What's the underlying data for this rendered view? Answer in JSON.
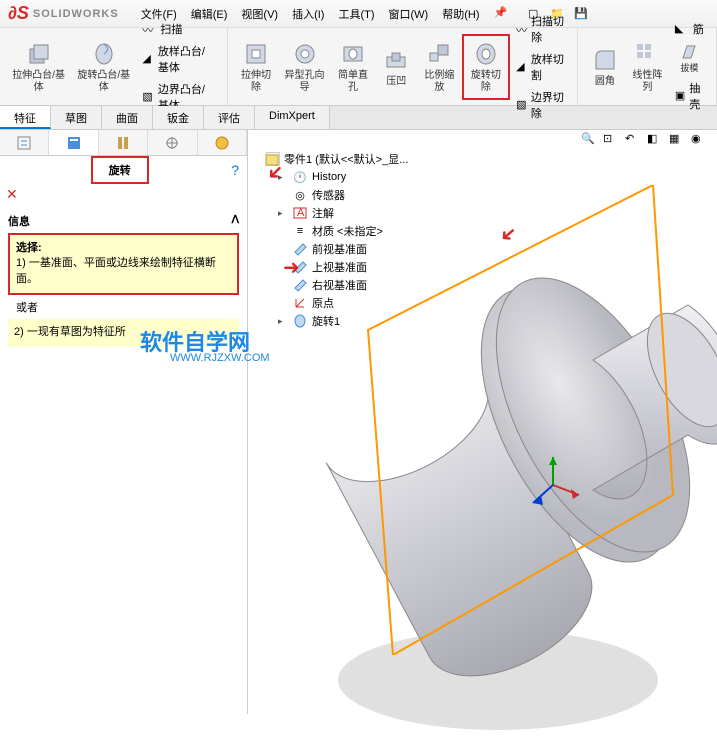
{
  "app": {
    "logo": "SOLIDWORKS",
    "menus": [
      "文件(F)",
      "编辑(E)",
      "视图(V)",
      "插入(I)",
      "工具(T)",
      "窗口(W)",
      "帮助(H)"
    ]
  },
  "ribbon": {
    "groups": [
      {
        "big": [
          {
            "label": "拉伸凸台/基体"
          },
          {
            "label": "旋转凸台/基体"
          }
        ],
        "small": [
          "扫描",
          "放样凸台/基体",
          "边界凸台/基体"
        ]
      },
      {
        "big": [
          {
            "label": "拉伸切除"
          },
          {
            "label": "异型孔向导"
          },
          {
            "label": "简单直孔"
          },
          {
            "label": "压凹"
          },
          {
            "label": "比例缩放"
          },
          {
            "label": "旋转切除",
            "highlight": true
          }
        ],
        "small": [
          "扫描切除",
          "放样切割",
          "边界切除"
        ]
      },
      {
        "big": [
          {
            "label": "圆角"
          },
          {
            "label": "线性阵列"
          },
          {
            "label": "拔模"
          }
        ],
        "small": [
          "筋",
          "抽壳"
        ]
      }
    ]
  },
  "tabs": [
    "特征",
    "草图",
    "曲面",
    "钣金",
    "评估",
    "DimXpert"
  ],
  "panel": {
    "title": "旋转",
    "info_header": "信息",
    "select_label": "选择:",
    "select_text": "1) 一基准面、平面或边线来绘制特征横断面。",
    "or_label": "或者",
    "alt_text": "2) 一现有草图为特征所"
  },
  "tree": {
    "root": "零件1 (默认<<默认>_显...",
    "items": [
      {
        "icon": "history",
        "label": "History"
      },
      {
        "icon": "sensor",
        "label": "传感器"
      },
      {
        "icon": "note",
        "label": "注解"
      },
      {
        "icon": "material",
        "label": "材质 <未指定>"
      },
      {
        "icon": "plane",
        "label": "前视基准面"
      },
      {
        "icon": "plane",
        "label": "上视基准面"
      },
      {
        "icon": "plane",
        "label": "右视基准面"
      },
      {
        "icon": "origin",
        "label": "原点"
      },
      {
        "icon": "revolve",
        "label": "旋转1"
      }
    ]
  },
  "watermark": {
    "main": "软件自学网",
    "sub": "WWW.RJZXW.COM"
  }
}
